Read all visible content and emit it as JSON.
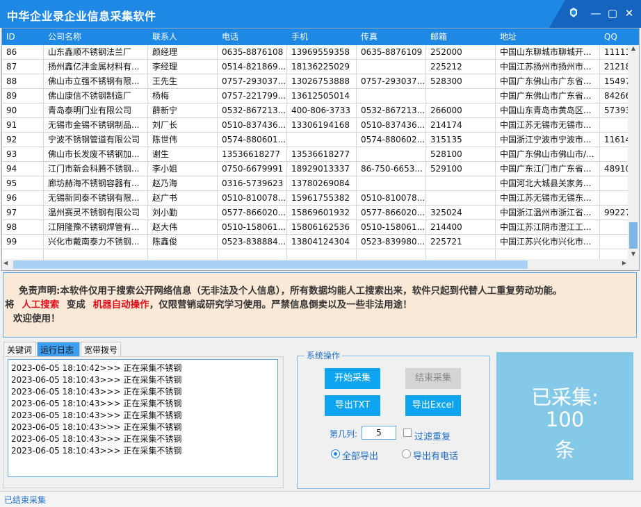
{
  "window": {
    "title": "中华企业录企业信息采集软件"
  },
  "grid": {
    "columns": [
      "ID",
      "公司名称",
      "联系人",
      "电话",
      "手机",
      "传真",
      "邮箱",
      "地址",
      "QQ"
    ],
    "rows": [
      [
        "86",
        "山东鑫顺不锈钢法兰厂",
        "颜经理",
        "0635-8876108",
        "13969559358",
        "0635-8876109",
        "252000",
        "中国山东聊城市聊城开...",
        "11111"
      ],
      [
        "87",
        "扬州鑫亿沣金属材料有...",
        "李经理",
        "0514-821869...",
        "18136225029",
        "",
        "225212",
        "中国江苏扬州市扬州市...",
        "21218"
      ],
      [
        "88",
        "佛山市立强不锈钢有限...",
        "王先生",
        "0757-293037...",
        "13026753888",
        "0757-293037...",
        "528300",
        "中国广东佛山市广东省...",
        "15497"
      ],
      [
        "89",
        "佛山康信不锈钢制造厂",
        "杨梅",
        "0757-221799...",
        "13612505014",
        "",
        "",
        "中国广东佛山市广东省...",
        "84266"
      ],
      [
        "90",
        "青岛泰明门业有限公司",
        "薛新宁",
        "0532-867213...",
        "400-806-3733",
        "0532-867213...",
        "266000",
        "中国山东青岛市黄岛区...",
        "57393"
      ],
      [
        "91",
        "无锡市金锡不锈钢制品...",
        "刘厂长",
        "0510-837436...",
        "13306194168",
        "0510-837436...",
        "214174",
        "中国江苏无锡市无锡市...",
        ""
      ],
      [
        "92",
        "宁波不锈钢管道有限公司",
        "陈世伟",
        "0574-880601...",
        "",
        "0574-880602...",
        "315135",
        "中国浙江宁波市宁波市...",
        "11614"
      ],
      [
        "93",
        "佛山市长发废不锈钢加...",
        "谢生",
        "13536618277",
        "13536618277",
        "",
        "528100",
        "中国广东佛山市佛山市/...",
        ""
      ],
      [
        "94",
        "江门市新会科腾不锈钢...",
        "李小姐",
        "0750-6679991",
        "18929013337",
        "86-750-6653...",
        "529100",
        "中国广东江门市广东省...",
        "48910"
      ],
      [
        "95",
        "廊坊赫海不锈钢容器有...",
        "赵乃海",
        "0316-5739623",
        "13780269084",
        "",
        "",
        "中国河北大城县关家务...",
        ""
      ],
      [
        "96",
        "无锡新同泰不锈钢有限...",
        "赵广书",
        "0510-810078...",
        "15961755382",
        "0510-810078...",
        "",
        "中国江苏无锡市无锡东...",
        ""
      ],
      [
        "97",
        "温州赛灵不锈钢有限公司",
        "刘小勤",
        "0577-866020...",
        "15869601932",
        "0577-866020...",
        "325024",
        "中国浙江温州市浙江省...",
        "99227"
      ],
      [
        "98",
        "江阴隆豫不锈钢焊管有...",
        "赵大伟",
        "0510-158061...",
        "15806162536",
        "0510-158061...",
        "214400",
        "中国江苏江阴市澄江工...",
        ""
      ],
      [
        "99",
        "兴化市戴南泰力不锈钢...",
        "陈鑫俊",
        "0523-838884...",
        "13804124304",
        "0523-839980...",
        "225721",
        "中国江苏兴化市兴化市...",
        ""
      ]
    ]
  },
  "notice": {
    "line1": "免责声明:本软件仅用于搜索公开网络信息（无非法及个人信息），所有数据均能人工搜索出来，软件只起到代替人工重复劳动功能。",
    "line2_a": "将",
    "line2_b": "人工搜索",
    "line2_c": "变成",
    "line2_d": "机器自动操作",
    "line2_e": "，仅限营销或研究学习使用。严禁信息倒卖以及一些非法用途！",
    "line3": "欢迎使用！"
  },
  "tabs": [
    "关键词",
    "运行日志",
    "宽带拨号"
  ],
  "log": [
    "2023-06-05 18:10:42>>> 正在采集不锈钢",
    "2023-06-05 18:10:43>>> 正在采集不锈钢",
    "2023-06-05 18:10:43>>> 正在采集不锈钢",
    "2023-06-05 18:10:43>>> 正在采集不锈钢",
    "2023-06-05 18:10:43>>> 正在采集不锈钢",
    "2023-06-05 18:10:43>>> 正在采集不锈钢",
    "2023-06-05 18:10:43>>> 正在采集不锈钢",
    "2023-06-05 18:10:43>>> 正在采集不锈钢"
  ],
  "ops": {
    "legend": "系统操作",
    "start": "开始采集",
    "stop": "结束采集",
    "export_txt": "导出TXT",
    "export_excel": "导出Excel",
    "column_label": "第几列:",
    "column_value": "5",
    "dedupe_label": "过滤重复",
    "radio_all": "全部导出",
    "radio_phone": "导出有电话"
  },
  "counter": {
    "line1": "已采集:",
    "line2": "100",
    "line3": "条"
  },
  "status": {
    "text": "已结束采集"
  }
}
